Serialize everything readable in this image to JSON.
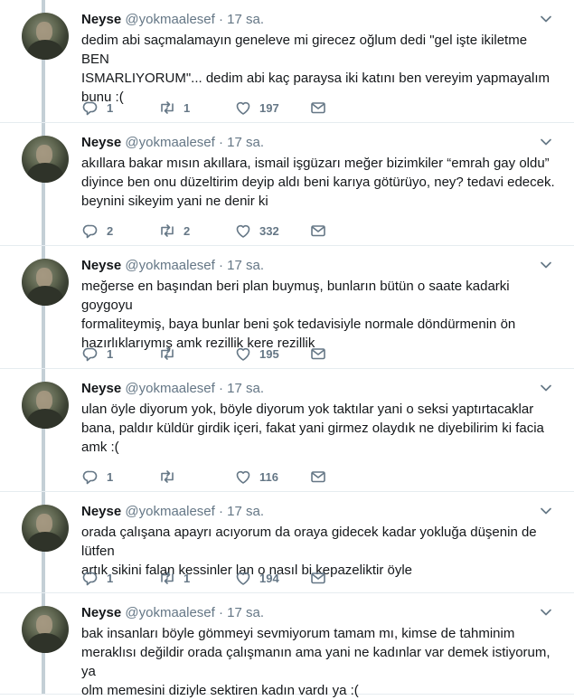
{
  "tweets": [
    {
      "name": "Neyse",
      "handle": "@yokmaalesef",
      "dot": "·",
      "time": "17 sa.",
      "text_lines": [
        "dedim abi saçmalamayın geneleve mi girecez oğlum dedi \"gel işte ikiletme BEN",
        "ISMARLIYORUM\"... dedim abi kaç paraysa iki katını ben vereyim yapmayalım",
        "bunu :("
      ],
      "replies": "1",
      "retweets": "1",
      "likes": "197"
    },
    {
      "name": "Neyse",
      "handle": "@yokmaalesef",
      "dot": "·",
      "time": "17 sa.",
      "text_lines": [
        "akıllara bakar mısın akıllara, ismail işgüzarı meğer bizimkiler “emrah gay oldu”",
        "diyince ben onu düzeltirim deyip aldı beni karıya götürüyo, ney? tedavi edecek.",
        "beynini sikeyim yani ne denir ki"
      ],
      "replies": "2",
      "retweets": "2",
      "likes": "332"
    },
    {
      "name": "Neyse",
      "handle": "@yokmaalesef",
      "dot": "·",
      "time": "17 sa.",
      "text_lines": [
        "meğerse en başından beri plan buymuş, bunların bütün o saate kadarki goygoyu",
        "formaliteymiş, baya bunlar beni şok tedavisiyle normale döndürmenin ön",
        "hazırlıklarıymış amk rezillik kere rezillik"
      ],
      "replies": "1",
      "retweets": "",
      "likes": "195"
    },
    {
      "name": "Neyse",
      "handle": "@yokmaalesef",
      "dot": "·",
      "time": "17 sa.",
      "text_lines": [
        "ulan öyle diyorum yok, böyle diyorum yok taktılar yani o seksi yaptırtacaklar",
        "bana, paldır küldür girdik içeri, fakat yani girmez olaydık ne diyebilirim ki facia",
        "amk :("
      ],
      "replies": "1",
      "retweets": "",
      "likes": "116"
    },
    {
      "name": "Neyse",
      "handle": "@yokmaalesef",
      "dot": "·",
      "time": "17 sa.",
      "text_lines": [
        "orada çalışana apayrı acıyorum da oraya gidecek kadar yokluğa düşenin de lütfen",
        "artık sikini falan kessinler lan o nasıl bi kepazeliktir öyle"
      ],
      "replies": "1",
      "retweets": "1",
      "likes": "194"
    },
    {
      "name": "Neyse",
      "handle": "@yokmaalesef",
      "dot": "·",
      "time": "17 sa.",
      "text_lines": [
        "bak insanları böyle gömmeyi sevmiyorum tamam mı, kimse de tahminim",
        "meraklısı değildir orada çalışmanın ama yani ne kadınlar var demek istiyorum, ya",
        "olm memesini diziyle sektiren kadın vardı ya :("
      ],
      "replies": "",
      "retweets": "",
      "likes": ""
    }
  ],
  "colors": {
    "text": "#14171a",
    "muted": "#657786",
    "thread_line": "#c4cfd6",
    "divider": "#e6ecf0"
  },
  "icons": [
    "reply-icon",
    "retweet-icon",
    "like-icon",
    "dm-icon",
    "chevron-down-icon"
  ]
}
